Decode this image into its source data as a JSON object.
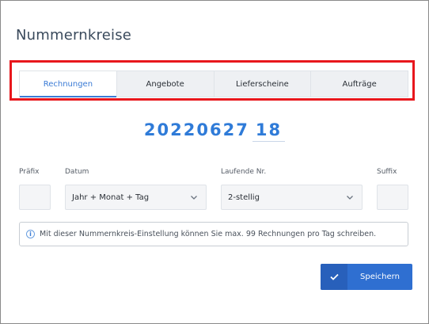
{
  "dialog": {
    "title": "Nummernkreise"
  },
  "tabs": [
    {
      "label": "Rechnungen",
      "active": true
    },
    {
      "label": "Angebote",
      "active": false
    },
    {
      "label": "Lieferscheine",
      "active": false
    },
    {
      "label": "Aufträge",
      "active": false
    }
  ],
  "preview": {
    "date_part": "20220627",
    "sequence_part": "18"
  },
  "fields": {
    "prefix": {
      "label": "Präfix",
      "value": ""
    },
    "date": {
      "label": "Datum",
      "value": "Jahr + Monat + Tag"
    },
    "sequence": {
      "label": "Laufende Nr.",
      "value": "2-stellig"
    },
    "suffix": {
      "label": "Suffix",
      "value": ""
    }
  },
  "info": {
    "text": "Mit dieser Nummernkreis-Einstellung können Sie max. 99 Rechnungen pro Tag schreiben."
  },
  "actions": {
    "save_label": "Speichern"
  },
  "colors": {
    "accent": "#2f6fd1",
    "highlight": "#e8171d"
  }
}
